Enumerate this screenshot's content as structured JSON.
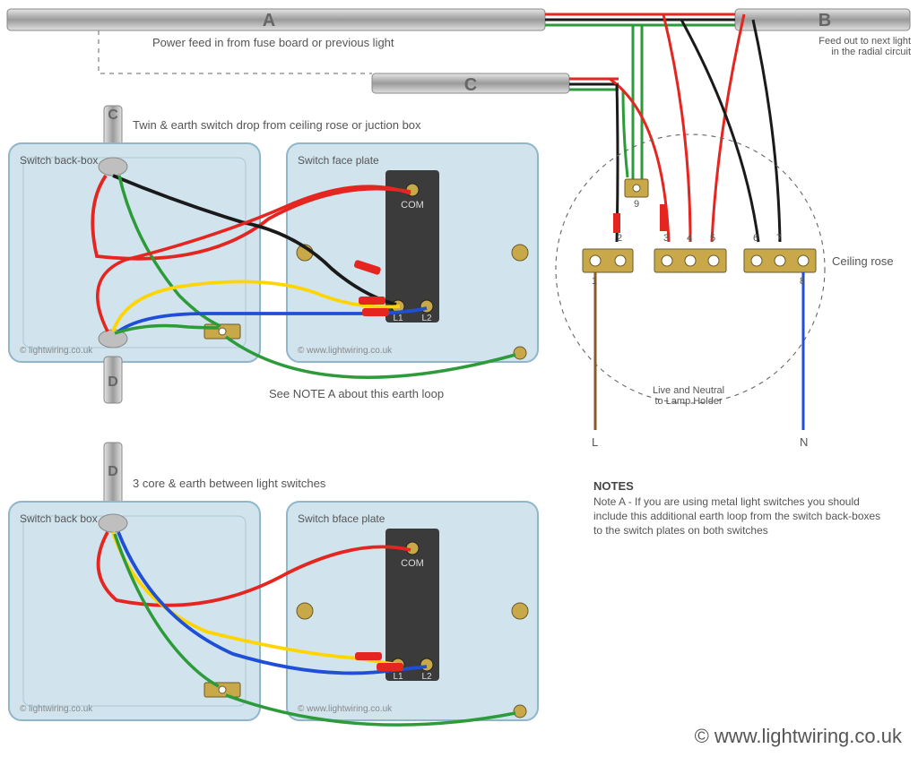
{
  "cables": {
    "A": {
      "letter": "A",
      "caption": "Power feed in from fuse board or previous light"
    },
    "B": {
      "letter": "B",
      "caption": "Feed out to next light\nin the radial circuit"
    },
    "C_top": {
      "letter": "C"
    },
    "C_side": {
      "letter": "C",
      "caption": "Twin & earth switch drop from ceiling rose or juction box"
    },
    "D1": {
      "letter": "D"
    },
    "D2": {
      "letter": "D",
      "caption": "3 core & earth between light switches"
    }
  },
  "switch1": {
    "back_title": "Switch back-box",
    "face_title": "Switch face plate",
    "terminals": {
      "com": "COM",
      "l1": "L1",
      "l2": "L2"
    },
    "copyright_back": "© lightwiring.co.uk",
    "copyright_face": "© www.lightwiring.co.uk",
    "earth_note": "See NOTE A about this earth loop"
  },
  "switch2": {
    "back_title": "Switch back box",
    "face_title": "Switch bface plate",
    "terminals": {
      "com": "COM",
      "l1": "L1",
      "l2": "L2"
    },
    "copyright_back": "© lightwiring.co.uk",
    "copyright_face": "© www.lightwiring.co.uk"
  },
  "ceiling_rose": {
    "title": "Ceiling rose",
    "terminals": [
      "1",
      "2",
      "3",
      "4",
      "5",
      "6",
      "7",
      "8"
    ],
    "binder": "9",
    "lamp_note": "Live and Neutral\nto Lamp Holder",
    "L": "L",
    "N": "N"
  },
  "notes": {
    "heading": "NOTES",
    "body": "Note A - If you are using metal light switches you should include this additional earth loop from the switch back-boxes to the switch plates on both switches"
  },
  "footer_copyright": "© www.lightwiring.co.uk",
  "colors": {
    "red": "#e52620",
    "black": "#1a1a1a",
    "green": "#2e9b3a",
    "yellow": "#ffd500",
    "blue": "#1f4fd6",
    "brown": "#8a5a2b",
    "grey": "#bfbfbf",
    "box_blue": "#d1e4ee",
    "box_border": "#8fb6c9",
    "block": "#3b3b3b",
    "brass": "#c9a84a"
  }
}
